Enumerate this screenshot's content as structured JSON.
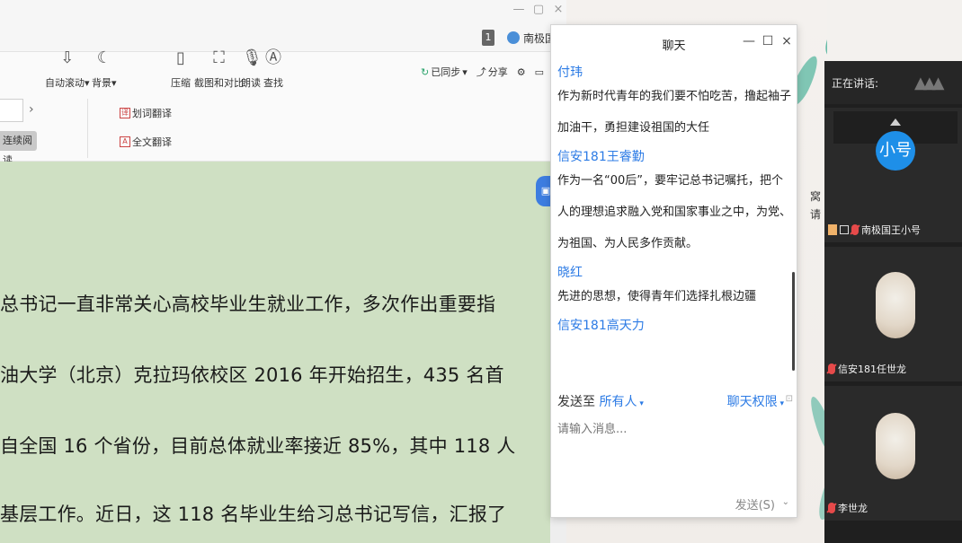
{
  "doc": {
    "win_controls": {
      "minimize": "—",
      "restore": "▢",
      "close": "×"
    },
    "tab_badge": "1",
    "user_chip": "南极国",
    "toolbar_top": [
      {
        "id": "sync",
        "label": "已同步",
        "icon": "cloud-sync-icon"
      },
      {
        "id": "share",
        "label": "分享",
        "icon": "share-icon"
      }
    ],
    "tools": {
      "continuous_read": "连续阅读",
      "auto_scroll": "自动滚动",
      "background": "背景",
      "word_translate": "划词翻译",
      "full_translate": "全文翻译",
      "compress": "压缩",
      "screenshot_compare": "截图和对比",
      "read_aloud": "朗读",
      "find": "查找"
    },
    "content_lines": [
      "总书记一直非常关心高校毕业生就业工作，多次作出重要指",
      "油大学（北京）克拉玛依校区 2016 年开始招生，435 名首",
      "自全国 16 个省份，目前总体就业率接近 85%，其中 118 人",
      "基层工作。近日，这 118 名毕业生给习总书记写信，汇报了"
    ]
  },
  "chat": {
    "title": "聊天",
    "controls": {
      "minimize": "—",
      "maximize": "☐",
      "close": "×"
    },
    "messages": [
      {
        "sender": "付玮",
        "text": "作为新时代青年的我们要不怕吃苦，撸起袖子加油干，勇担建设祖国的大任"
      },
      {
        "sender": "信安181王睿勤",
        "text": "作为一名“00后”，要牢记总书记嘱托，把个人的理想追求融入党和国家事业之中，为党、为祖国、为人民多作贡献。"
      },
      {
        "sender": "晓红",
        "text": "先进的思想，使得青年们选择扎根边疆"
      },
      {
        "sender": "信安181高天力",
        "text": ""
      }
    ],
    "send_to_label": "发送至",
    "send_to_value": "所有人",
    "permissions_label": "聊天权限",
    "input_placeholder": "请输入消息...",
    "send_button": "发送(S)"
  },
  "art": {
    "text_line1": "窝",
    "text_line2": "请"
  },
  "panel": {
    "header": "正在讲话:",
    "participants": [
      {
        "name": "南极国王小号",
        "avatar_text": "小号",
        "avatar_type": "blue",
        "muted": true
      },
      {
        "name": "信安181任世龙",
        "avatar_text": "",
        "avatar_type": "photo",
        "muted": true
      },
      {
        "name": "李世龙",
        "avatar_text": "",
        "avatar_type": "photo",
        "muted": true
      }
    ]
  },
  "colors": {
    "accent": "#2c7be5",
    "doc_bg": "#cfe0c3",
    "panel_bg": "#1f1f1f",
    "avatar_blue": "#1e8fe8"
  }
}
